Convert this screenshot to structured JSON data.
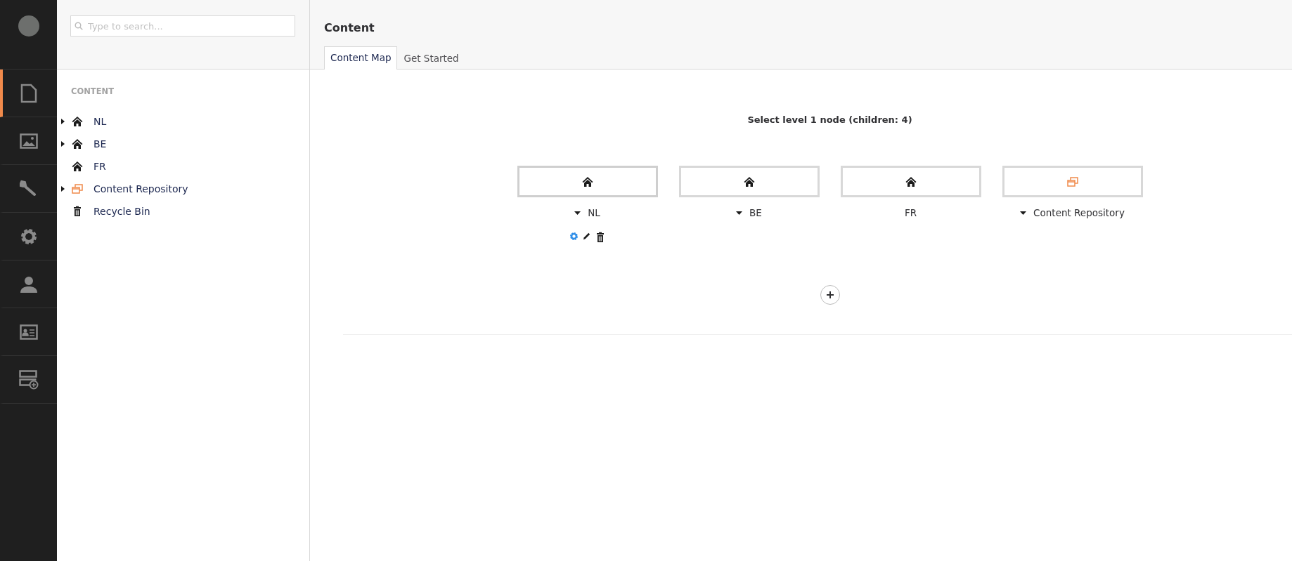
{
  "sections": [
    {
      "kind": "document",
      "selected": true
    },
    {
      "kind": "image",
      "selected": false
    },
    {
      "kind": "wrench",
      "selected": false
    },
    {
      "kind": "gear",
      "selected": false
    },
    {
      "kind": "person",
      "selected": false
    },
    {
      "kind": "card",
      "selected": false
    },
    {
      "kind": "form",
      "selected": false
    }
  ],
  "search": {
    "placeholder": "Type to search..."
  },
  "tree": {
    "heading": "CONTENT",
    "items": [
      {
        "kind": "home",
        "label": "NL",
        "expandable": true
      },
      {
        "kind": "home",
        "label": "BE",
        "expandable": true
      },
      {
        "kind": "home",
        "label": "FR",
        "expandable": false
      },
      {
        "kind": "repository",
        "label": "Content Repository",
        "expandable": true
      },
      {
        "kind": "bin",
        "label": "Recycle Bin",
        "expandable": false
      }
    ]
  },
  "header": {
    "title": "Content"
  },
  "tabs": [
    {
      "label": "Content Map",
      "selected": true
    },
    {
      "label": "Get Started",
      "selected": false
    }
  ],
  "content_map": {
    "caption": "Select level 1 node (children: 4)",
    "nodes": [
      {
        "kind": "home",
        "label": "NL",
        "expandable": true,
        "selected": true
      },
      {
        "kind": "home",
        "label": "BE",
        "expandable": true,
        "selected": false
      },
      {
        "kind": "home",
        "label": "FR",
        "expandable": false,
        "selected": false
      },
      {
        "kind": "repository",
        "label": "Content Repository",
        "expandable": true,
        "selected": false
      }
    ]
  }
}
